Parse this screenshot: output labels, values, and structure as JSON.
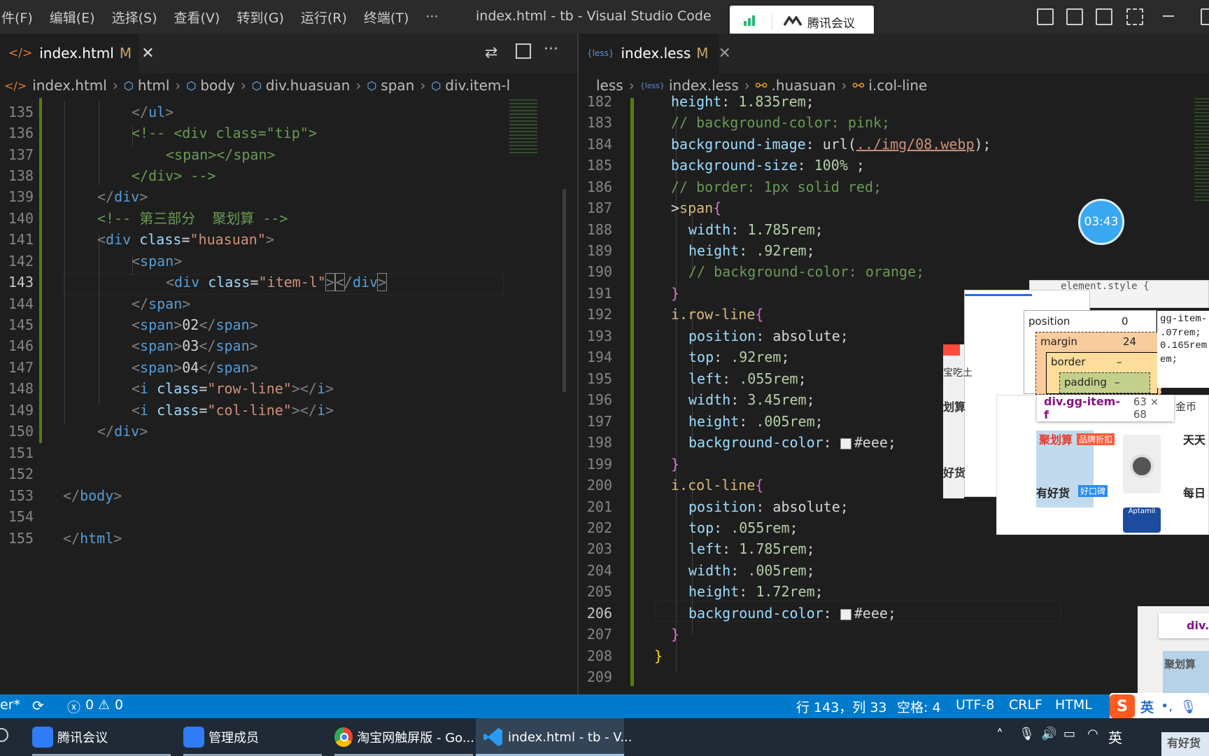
{
  "titlebar": {
    "menus": [
      "件(F)",
      "编辑(E)",
      "选择(S)",
      "查看(V)",
      "转到(G)",
      "运行(R)",
      "终端(T)",
      "···"
    ],
    "window_title": "index.html - tb - Visual Studio Code",
    "meeting_label": "腾讯会议"
  },
  "left_editor": {
    "tab": {
      "label": "index.html",
      "modified": "M",
      "close": "✕"
    },
    "breadcrumb": [
      "index.html",
      "html",
      "body",
      "div.huasuan",
      "span",
      "div.item-l"
    ]
  },
  "right_editor": {
    "tab": {
      "label": "index.less",
      "modified": "M",
      "close": "✕",
      "icon_text": "{less}"
    },
    "breadcrumb": [
      "less",
      "index.less",
      ".huasuan",
      "i.col-line"
    ]
  },
  "timer": "03:43",
  "devtools": {
    "element_style": "element.style {",
    "position_label": "position",
    "position_value": "0",
    "margin_label": "margin",
    "margin_value": "24",
    "border_label": "border",
    "border_value": "–",
    "padding_label": "padding",
    "padding_value": "–",
    "css_lines": [
      "gg-item-",
      ".07rem;",
      "0.165rem",
      "em;"
    ],
    "tooltip_selector": "div.gg-item-f",
    "tooltip_size": "63 × 68",
    "preview_labels": [
      "聚划算",
      "品牌折扣",
      "天天",
      "有好货",
      "好口碑",
      "每日",
      "金币",
      "Aptamil"
    ],
    "side_labels": [
      "宝吃土",
      "划算",
      "好货"
    ],
    "mini_label": "div.",
    "mini_preview": "聚划算",
    "mini_bottom": "有好货"
  },
  "statusbar": {
    "left": "er*",
    "errors": "0",
    "warnings": "0",
    "position": "行 143，列 33",
    "spaces": "空格: 4",
    "encoding": "UTF-8",
    "eol": "CRLF",
    "language": "HTML",
    "ime": "英"
  },
  "taskbar": {
    "items": [
      "腾讯会议",
      "管理成员",
      "淘宝网触屏版 - Go...",
      "index.html - tb - V..."
    ],
    "tray_ime": "英"
  }
}
